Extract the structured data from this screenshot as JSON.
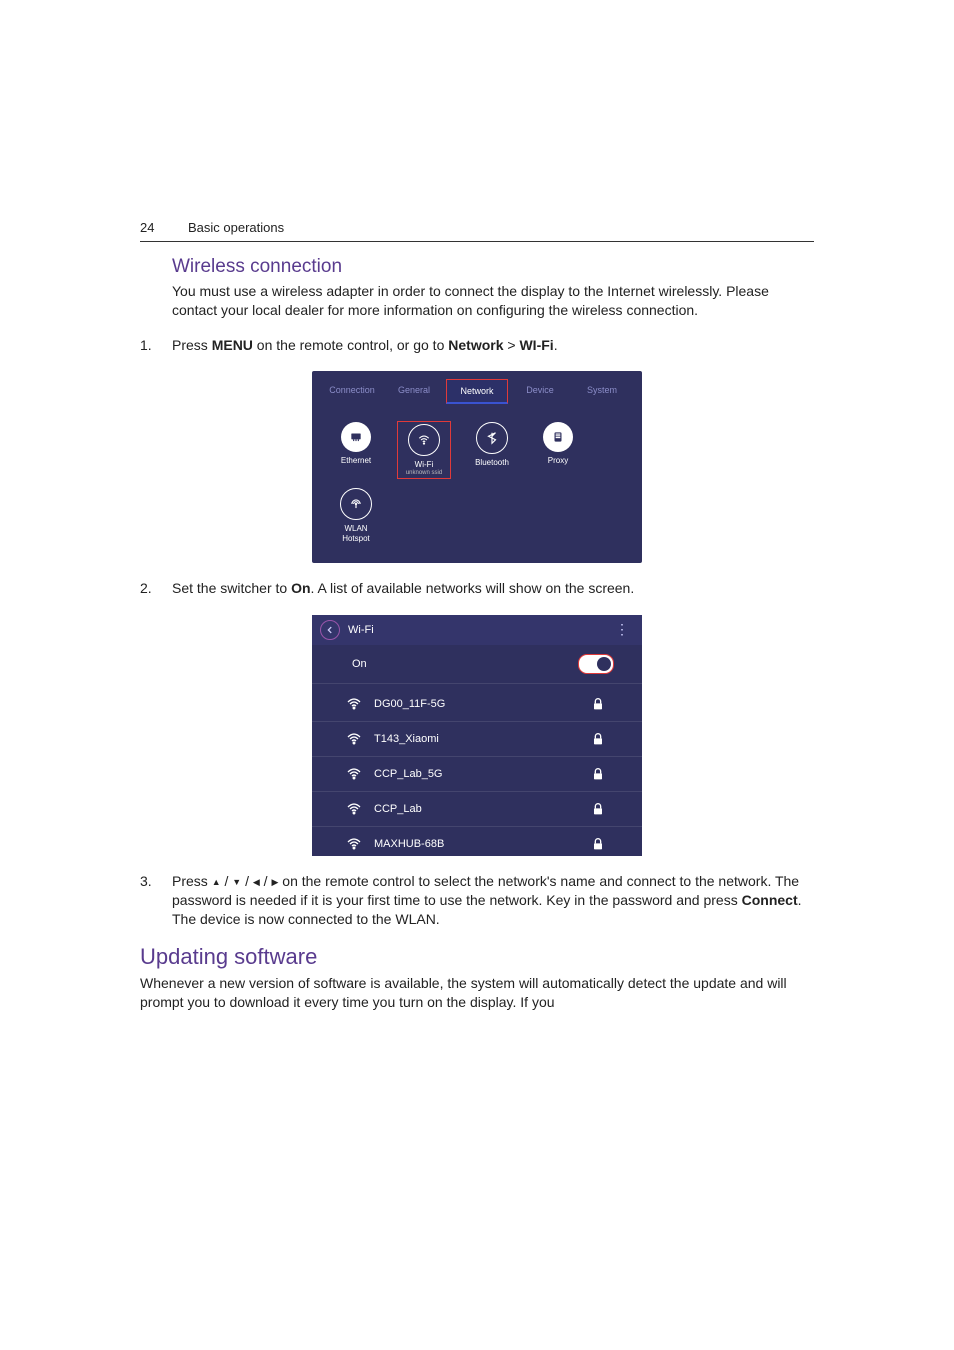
{
  "header": {
    "page_number": "24",
    "section": "Basic operations"
  },
  "wireless": {
    "heading": "Wireless connection",
    "intro": "You must use a wireless adapter in order to connect the display to the Internet wirelessly. Please contact your local dealer for more information on configuring the wireless connection.",
    "step1": {
      "n": "1.",
      "pre": "Press ",
      "menu": "MENU",
      "mid": " on the remote control, or go to ",
      "path1": "Network",
      "sep": " > ",
      "path2": "WI-Fi",
      "end": "."
    },
    "step2": {
      "n": "2.",
      "pre": "Set the switcher to ",
      "on": "On",
      "end": ". A list of available networks will show on the screen."
    },
    "step3": {
      "n": "3.",
      "pre": "Press ",
      "mid": " on the remote control to select the network's name and connect to the network. The password is needed if it is your first time to use the network. Key in the password and press ",
      "connect": "Connect",
      "end": ". The device is now connected to the WLAN."
    }
  },
  "panel1": {
    "tabs": [
      "Connection",
      "General",
      "Network",
      "Device",
      "System"
    ],
    "active_tab_index": 2,
    "tiles": [
      {
        "label": "Ethernet"
      },
      {
        "label": "Wi-Fi",
        "sub": "unknown ssid"
      },
      {
        "label": "Bluetooth"
      },
      {
        "label": "Proxy"
      },
      {
        "label": "WLAN Hotspot"
      }
    ]
  },
  "panel2": {
    "title": "Wi-Fi",
    "toggle_label": "On",
    "networks": [
      {
        "ssid": "DG00_11F-5G",
        "locked": true
      },
      {
        "ssid": "T143_Xiaomi",
        "locked": true
      },
      {
        "ssid": "CCP_Lab_5G",
        "locked": true
      },
      {
        "ssid": "CCP_Lab",
        "locked": true
      },
      {
        "ssid": "MAXHUB-68B",
        "locked": true
      }
    ]
  },
  "updating": {
    "heading": "Updating software",
    "body": "Whenever a new version of software is available, the system will automatically detect the update and will prompt you to download it every time you turn on the display. If you"
  }
}
